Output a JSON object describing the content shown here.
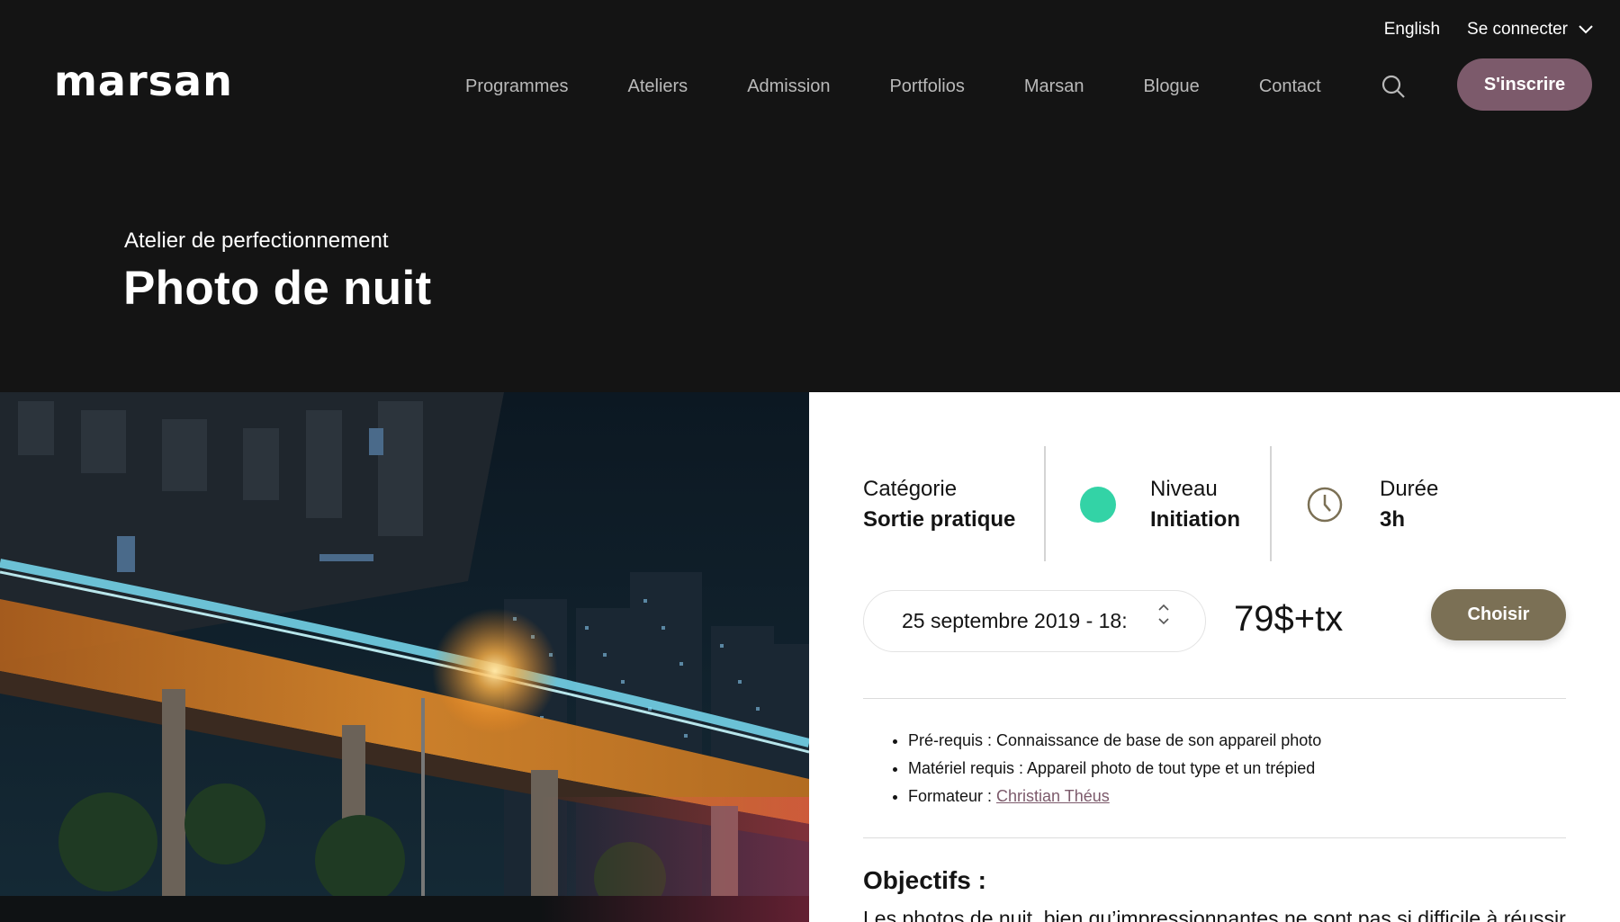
{
  "topbar": {
    "language": "English",
    "login": "Se connecter"
  },
  "logo": {
    "text": "marsan"
  },
  "nav": {
    "items": [
      "Programmes",
      "Ateliers",
      "Admission",
      "Portfolios",
      "Marsan",
      "Blogue",
      "Contact"
    ],
    "signup": "S'inscrire"
  },
  "hero": {
    "subtitle": "Atelier de perfectionnement",
    "title": "Photo de nuit"
  },
  "info": {
    "category_label": "Catégorie",
    "category_value": "Sortie pratique",
    "level_label": "Niveau",
    "level_value": "Initiation",
    "duration_label": "Durée",
    "duration_value": "3h"
  },
  "booking": {
    "date": "25 septembre 2019 - 18:",
    "price": "79$+tx",
    "choose": "Choisir"
  },
  "details": {
    "prereq": "Pré-requis : Connaissance de base de son appareil photo",
    "material": "Matériel requis : Appareil photo de tout type et un trépied",
    "trainer_label": "Formateur : ",
    "trainer_name": "Christian Théus"
  },
  "objectives": {
    "title": "Objectifs :",
    "text": "Les photos de nuit, bien qu’impressionnantes ne sont pas si difficile à réussir"
  },
  "colors": {
    "accent_purple": "#7c5a6b",
    "accent_olive": "#7b7055",
    "level_dot": "#33d3a6"
  }
}
